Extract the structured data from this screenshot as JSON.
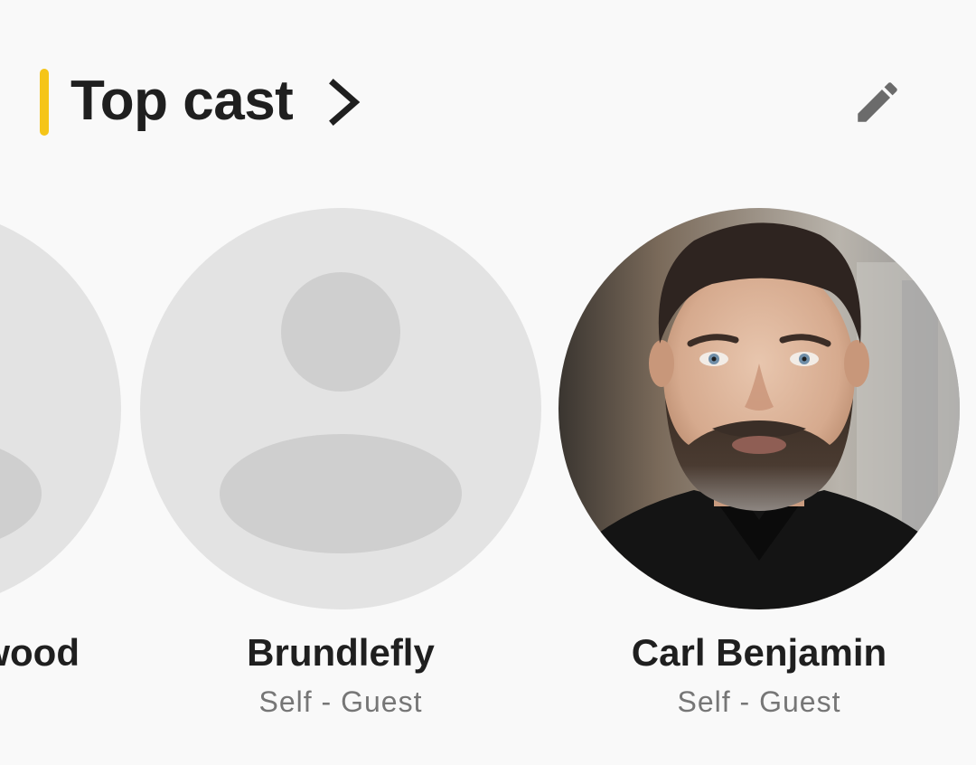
{
  "colors": {
    "accent": "#f5c518",
    "background": "#f9f9f9",
    "placeholder_bg": "#e3e3e3",
    "placeholder_figure": "#cfcfcf",
    "title_text": "#1f1f1f",
    "secondary_text": "#767676",
    "icon_gray": "#6b6b6b"
  },
  "section": {
    "title": "Top cast",
    "chevron_icon": "chevron-right-icon",
    "edit_icon": "pencil-icon"
  },
  "cast": [
    {
      "name": "wood",
      "role": "",
      "photo": "placeholder"
    },
    {
      "name": "Brundlefly",
      "role": "Self - Guest",
      "photo": "placeholder"
    },
    {
      "name": "Carl Benjamin",
      "role": "Self - Guest",
      "photo": "headshot"
    }
  ]
}
